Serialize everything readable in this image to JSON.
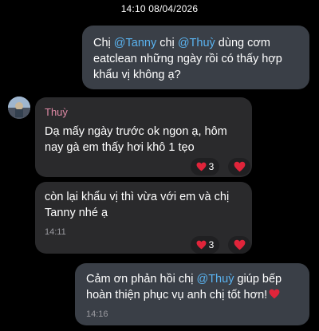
{
  "chat": {
    "date_time": "14:10 08/04/2026"
  },
  "messages": {
    "m1": {
      "prefix": "Chị ",
      "mention1": "@Tanny",
      "mid": " chị ",
      "mention2": "@Thuỳ",
      "text": " dùng cơm eatclean những ngày rồi có thấy hợp khẩu vị không ạ?"
    },
    "m2": {
      "sender": "Thuỳ",
      "text": "Dạ mấy ngày trước ok ngon ạ, hôm nay gà em thấy hơi khô 1 tẹo",
      "reaction": {
        "emoji": "heart",
        "count": "3"
      }
    },
    "m3": {
      "text": "còn lại khẩu vị thì vừa với em và chị Tanny nhé ạ",
      "time": "14:11",
      "reaction": {
        "emoji": "heart",
        "count": "3"
      }
    },
    "m4": {
      "prefix": "Cảm ơn phản hồi chị ",
      "mention": "@Thuỳ",
      "text": " giúp bếp hoàn thiện phục vụ anh chị tốt hơn!",
      "time": "14:16"
    }
  },
  "colors": {
    "mention": "#5ab3f0",
    "sender_name": "#e08aa6",
    "heart": "#e0243a",
    "outgoing_bubble": "#3a3f47",
    "incoming_bubble": "#2a2a2c"
  }
}
